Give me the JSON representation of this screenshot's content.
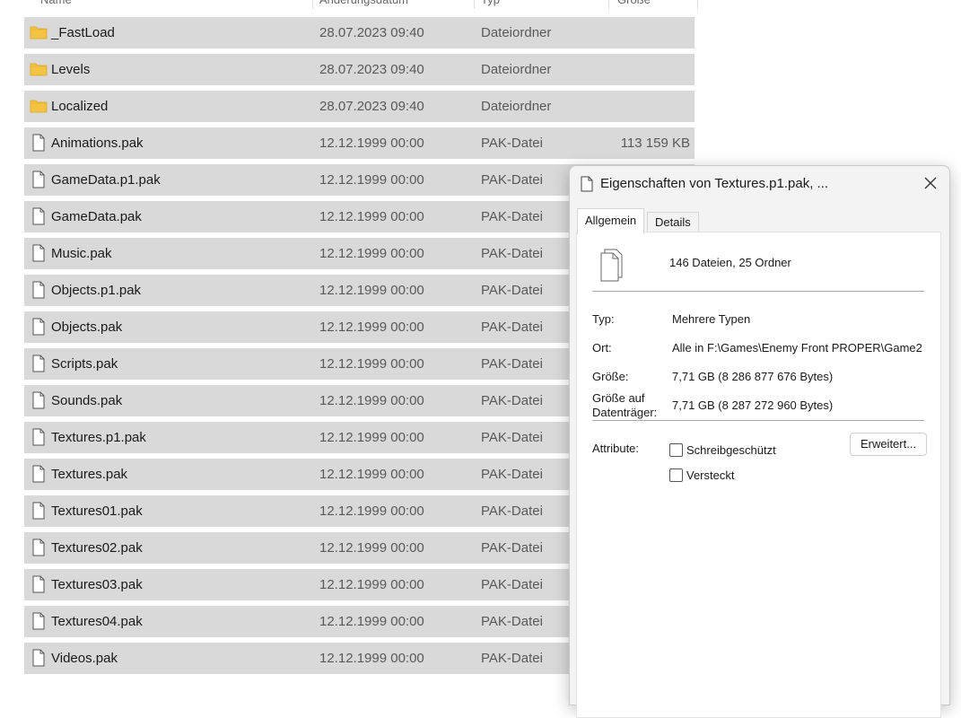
{
  "columns": {
    "name": "Name",
    "date": "Änderungsdatum",
    "type": "Typ",
    "size": "Größe"
  },
  "files": [
    {
      "name": "_FastLoad",
      "date": "28.07.2023 09:40",
      "type": "Dateiordner",
      "size": "",
      "icon": "folder-icon"
    },
    {
      "name": "Levels",
      "date": "28.07.2023 09:40",
      "type": "Dateiordner",
      "size": "",
      "icon": "folder-icon"
    },
    {
      "name": "Localized",
      "date": "28.07.2023 09:40",
      "type": "Dateiordner",
      "size": "",
      "icon": "folder-icon"
    },
    {
      "name": "Animations.pak",
      "date": "12.12.1999 00:00",
      "type": "PAK-Datei",
      "size": "113 159 KB",
      "icon": "file-icon"
    },
    {
      "name": "GameData.p1.pak",
      "date": "12.12.1999 00:00",
      "type": "PAK-Datei",
      "size": "",
      "icon": "file-icon"
    },
    {
      "name": "GameData.pak",
      "date": "12.12.1999 00:00",
      "type": "PAK-Datei",
      "size": "",
      "icon": "file-icon"
    },
    {
      "name": "Music.pak",
      "date": "12.12.1999 00:00",
      "type": "PAK-Datei",
      "size": "",
      "icon": "file-icon"
    },
    {
      "name": "Objects.p1.pak",
      "date": "12.12.1999 00:00",
      "type": "PAK-Datei",
      "size": "",
      "icon": "file-icon"
    },
    {
      "name": "Objects.pak",
      "date": "12.12.1999 00:00",
      "type": "PAK-Datei",
      "size": "",
      "icon": "file-icon"
    },
    {
      "name": "Scripts.pak",
      "date": "12.12.1999 00:00",
      "type": "PAK-Datei",
      "size": "",
      "icon": "file-icon"
    },
    {
      "name": "Sounds.pak",
      "date": "12.12.1999 00:00",
      "type": "PAK-Datei",
      "size": "",
      "icon": "file-icon"
    },
    {
      "name": "Textures.p1.pak",
      "date": "12.12.1999 00:00",
      "type": "PAK-Datei",
      "size": "",
      "icon": "file-icon"
    },
    {
      "name": "Textures.pak",
      "date": "12.12.1999 00:00",
      "type": "PAK-Datei",
      "size": "",
      "icon": "file-icon"
    },
    {
      "name": "Textures01.pak",
      "date": "12.12.1999 00:00",
      "type": "PAK-Datei",
      "size": "",
      "icon": "file-icon"
    },
    {
      "name": "Textures02.pak",
      "date": "12.12.1999 00:00",
      "type": "PAK-Datei",
      "size": "",
      "icon": "file-icon"
    },
    {
      "name": "Textures03.pak",
      "date": "12.12.1999 00:00",
      "type": "PAK-Datei",
      "size": "",
      "icon": "file-icon"
    },
    {
      "name": "Textures04.pak",
      "date": "12.12.1999 00:00",
      "type": "PAK-Datei",
      "size": "",
      "icon": "file-icon"
    },
    {
      "name": "Videos.pak",
      "date": "12.12.1999 00:00",
      "type": "PAK-Datei",
      "size": "",
      "icon": "file-icon"
    }
  ],
  "dialog": {
    "title": "Eigenschaften von Textures.p1.pak, ...",
    "tabs": [
      "Allgemein",
      "Details"
    ],
    "active_tab": "Allgemein",
    "summary": "146 Dateien, 25 Ordner",
    "properties": {
      "type_label": "Typ:",
      "type_value": "Mehrere Typen",
      "location_label": "Ort:",
      "location_value": "Alle in F:\\Games\\Enemy Front PROPER\\Game2",
      "size_label": "Größe:",
      "size_value": "7,71 GB (8 286 877 676 Bytes)",
      "disk_size_label_line1": "Größe auf",
      "disk_size_label_line2": "Datenträger:",
      "disk_size_value": "7,71 GB (8 287 272 960 Bytes)"
    },
    "attributes": {
      "label": "Attribute:",
      "readonly_label": "Schreibgeschützt",
      "readonly_checked": false,
      "hidden_label": "Versteckt",
      "hidden_checked": false,
      "advanced_button": "Erweitert..."
    }
  },
  "colors": {
    "row_selected": "#d9d9d9",
    "folder": "#f5c342",
    "dialog_bg": "#f3f3f3"
  }
}
